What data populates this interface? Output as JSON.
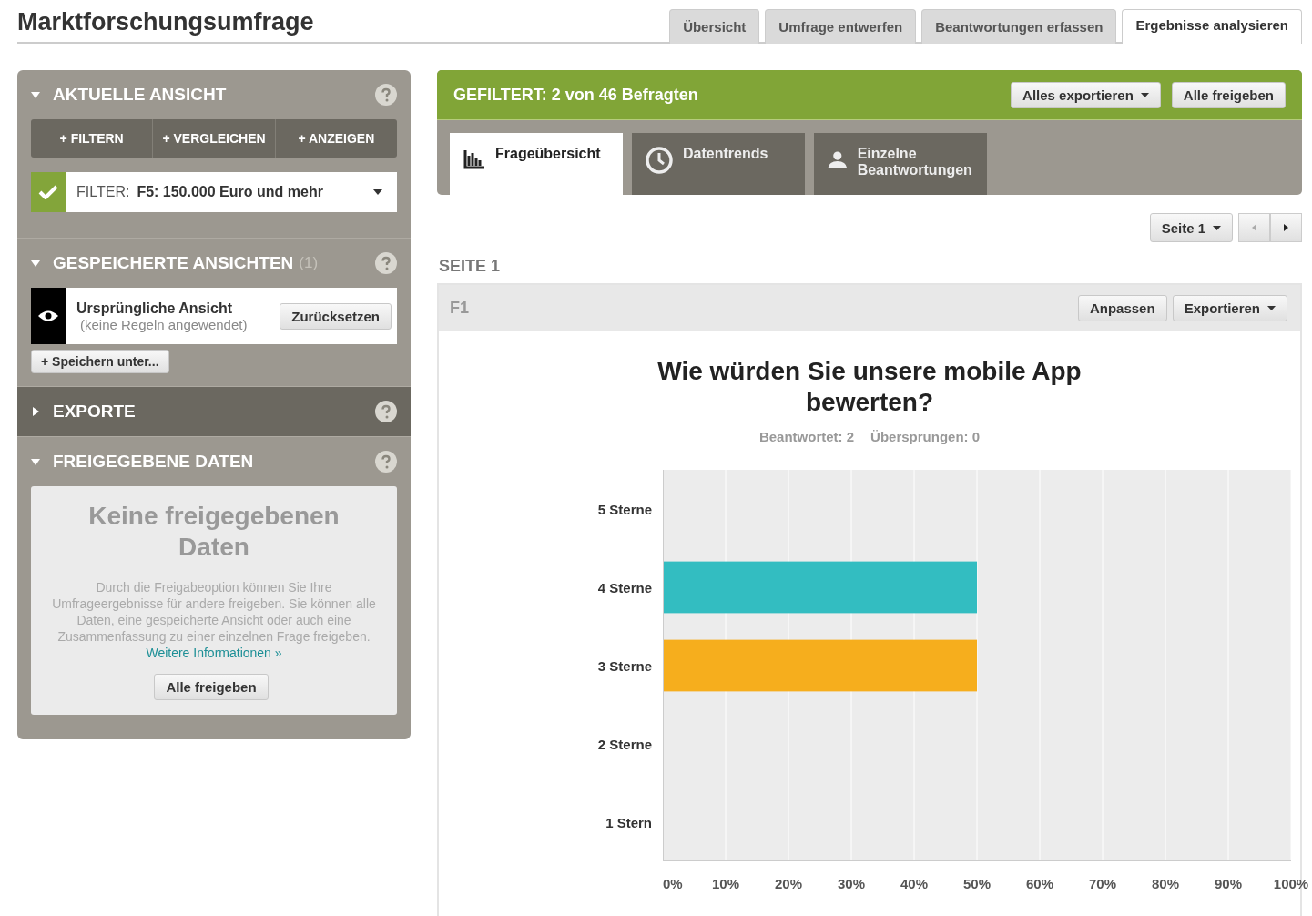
{
  "title": "Marktforschungsumfrage",
  "tabs": [
    {
      "label": "Übersicht",
      "selected": false
    },
    {
      "label": "Umfrage entwerfen",
      "selected": false
    },
    {
      "label": "Beantwortungen erfassen",
      "selected": false
    },
    {
      "label": "Ergebnisse analysieren",
      "selected": true
    }
  ],
  "sidebar": {
    "sections": [
      {
        "kind": "current",
        "title": "AKTUELLE ANSICHT",
        "expanded": true,
        "actions": [
          "+ FILTERN",
          "+ VERGLEICHEN",
          "+ ANZEIGEN"
        ],
        "filter": {
          "checked": true,
          "label": "FILTER:",
          "value": "F5: 150.000 Euro und mehr"
        }
      },
      {
        "kind": "saved",
        "title": "GESPEICHERTE ANSICHTEN",
        "count": "(1)",
        "expanded": true,
        "view": {
          "name": "Ursprüngliche Ansicht",
          "note": "(keine Regeln angewendet)",
          "button": "Zurücksetzen"
        },
        "save_button": "+ Speichern unter..."
      },
      {
        "kind": "exports",
        "title": "EXPORTE",
        "expanded": false
      },
      {
        "kind": "shared",
        "title": "FREIGEGEBENE DATEN",
        "expanded": true,
        "heading": "Keine freigegebenen Daten",
        "text": "Durch die Freigabeoption können Sie Ihre Umfrageergebnisse für andere freigeben. Sie können alle Daten, eine gespeicherte Ansicht oder auch eine Zusammenfassung zu einer einzelnen Frage freigeben.",
        "link": "Weitere Informationen »",
        "button": "Alle freigeben"
      }
    ]
  },
  "banner": {
    "text": "GEFILTERT: 2 von 46 Befragten",
    "buttons": [
      {
        "label": "Alles exportieren",
        "dropdown": true
      },
      {
        "label": "Alle freigeben",
        "dropdown": false
      }
    ]
  },
  "view_tabs": [
    {
      "kind": "chart",
      "label": "Frageübersicht",
      "selected": true
    },
    {
      "kind": "clock",
      "label": "Datentrends",
      "selected": false
    },
    {
      "kind": "person",
      "label": "Einzelne Beantwortungen",
      "selected": false
    }
  ],
  "pager": {
    "page": "Seite 1"
  },
  "page_label": "SEITE 1",
  "question": {
    "id": "F1",
    "buttons": [
      {
        "label": "Anpassen",
        "dropdown": false
      },
      {
        "label": "Exportieren",
        "dropdown": true
      }
    ],
    "title": "Wie würden Sie unsere mobile App bewerten?",
    "answered": "Beantwortet: 2",
    "skipped": "Übersprungen: 0",
    "chart_data": {
      "type": "bar",
      "orientation": "horizontal",
      "stacked": true,
      "categories": [
        "5 Sterne",
        "4 Sterne",
        "3 Sterne",
        "2 Sterne",
        "1 Stern"
      ],
      "grid": true,
      "series": [
        {
          "color": "#33bdc1",
          "values": [
            null,
            50,
            null,
            null,
            null
          ]
        },
        {
          "color": "#f6ae1d",
          "values": [
            null,
            null,
            50,
            null,
            null
          ]
        }
      ],
      "xlim": [
        0,
        100
      ],
      "xticks": [
        {
          "value": 0,
          "label": "0%"
        },
        {
          "value": 10,
          "label": "10%"
        },
        {
          "value": 20,
          "label": "20%"
        },
        {
          "value": 30,
          "label": "30%"
        },
        {
          "value": 40,
          "label": "40%"
        },
        {
          "value": 50,
          "label": "50%"
        },
        {
          "value": 60,
          "label": "60%"
        },
        {
          "value": 70,
          "label": "70%"
        },
        {
          "value": 80,
          "label": "80%"
        },
        {
          "value": 90,
          "label": "90%"
        },
        {
          "value": 100,
          "label": "100%"
        }
      ]
    }
  }
}
